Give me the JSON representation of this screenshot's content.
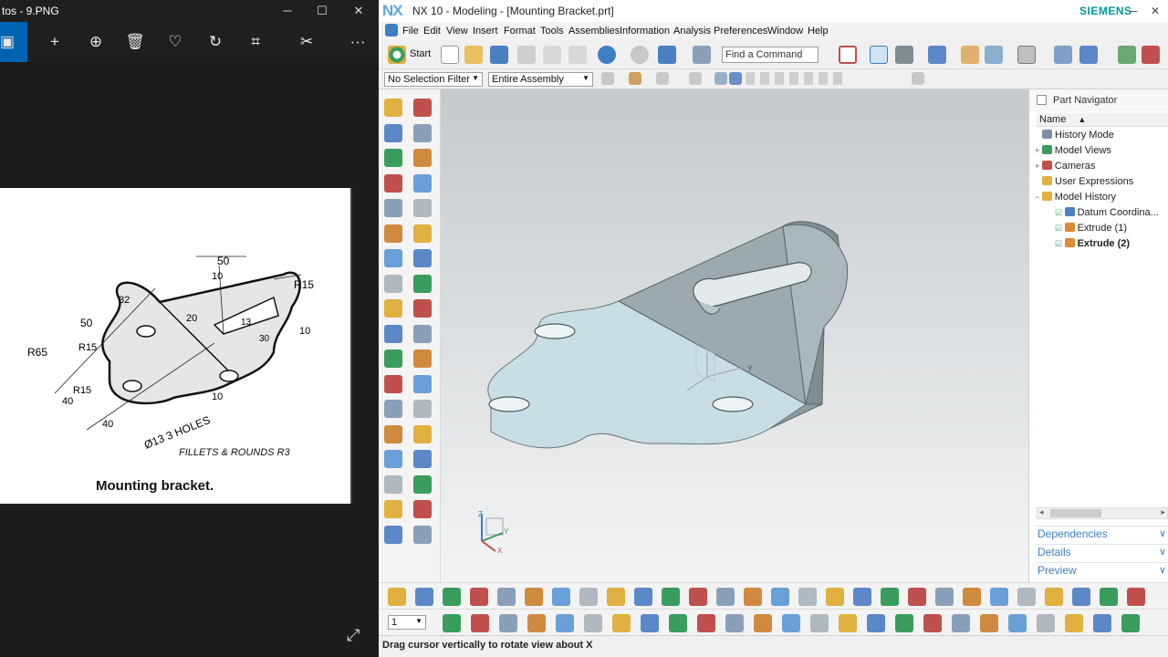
{
  "photos": {
    "title": "tos - 9.PNG",
    "caption": "Mounting bracket.",
    "note": "FILLETS & ROUNDS R3",
    "dims": [
      "50",
      "10",
      "R15",
      "32",
      "20",
      "13",
      "30",
      "50",
      "R15",
      "10",
      "R65",
      "40",
      "R15",
      "40",
      "10",
      "Ø13 3 HOLES"
    ]
  },
  "nx": {
    "logo": "NX",
    "title": "NX 10 - Modeling - [Mounting Bracket.prt]",
    "brand": "SIEMENS",
    "menu": [
      {
        "label": "File",
        "key": "F"
      },
      {
        "label": "Edit",
        "key": "E"
      },
      {
        "label": "View",
        "key": "V"
      },
      {
        "label": "Insert",
        "key": "I"
      },
      {
        "label": "Format",
        "key": "F"
      },
      {
        "label": "Tools",
        "key": "T"
      },
      {
        "label": "Assemblies",
        "key": "A"
      },
      {
        "label": "Information",
        "key": "I"
      },
      {
        "label": "Analysis",
        "key": "A"
      },
      {
        "label": "Preferences",
        "key": "P"
      },
      {
        "label": "Window",
        "key": "W"
      },
      {
        "label": "Help",
        "key": "H"
      }
    ],
    "start_label": "Start",
    "find_command_placeholder": "Find a Command",
    "selection_filter": "No Selection Filter",
    "assembly_scope": "Entire Assembly",
    "layer_value": "1",
    "status_text": "Drag cursor vertically to rotate view about X",
    "navigator": {
      "title": "Part Navigator",
      "column": "Name",
      "items": [
        {
          "label": "History Mode",
          "bold": false,
          "icon_color": "#7a8fa6"
        },
        {
          "label": "Model Views",
          "bold": false,
          "icon_color": "#3a9d5d"
        },
        {
          "label": "Cameras",
          "bold": false,
          "icon_color": "#c0504d"
        },
        {
          "label": "User Expressions",
          "bold": false,
          "icon_color": "#e0b040"
        },
        {
          "label": "Model History",
          "bold": false,
          "icon_color": "#e0b040"
        },
        {
          "label": "Datum Coordina...",
          "bold": false,
          "icon_color": "#4a7fc0"
        },
        {
          "label": "Extrude (1)",
          "bold": false,
          "icon_color": "#e08a30"
        },
        {
          "label": "Extrude (2)",
          "bold": true,
          "icon_color": "#e08a30"
        }
      ],
      "sections": [
        "Dependencies",
        "Details",
        "Preview"
      ]
    },
    "triad_labels": {
      "z": "Z",
      "y": "Y",
      "x": "X"
    },
    "colors": {
      "accent": "#0063b1",
      "nx_blue": "#5fa6d8",
      "siemens": "#009999",
      "part_top": "#c9dde4",
      "part_side": "#8d9aa0"
    }
  }
}
